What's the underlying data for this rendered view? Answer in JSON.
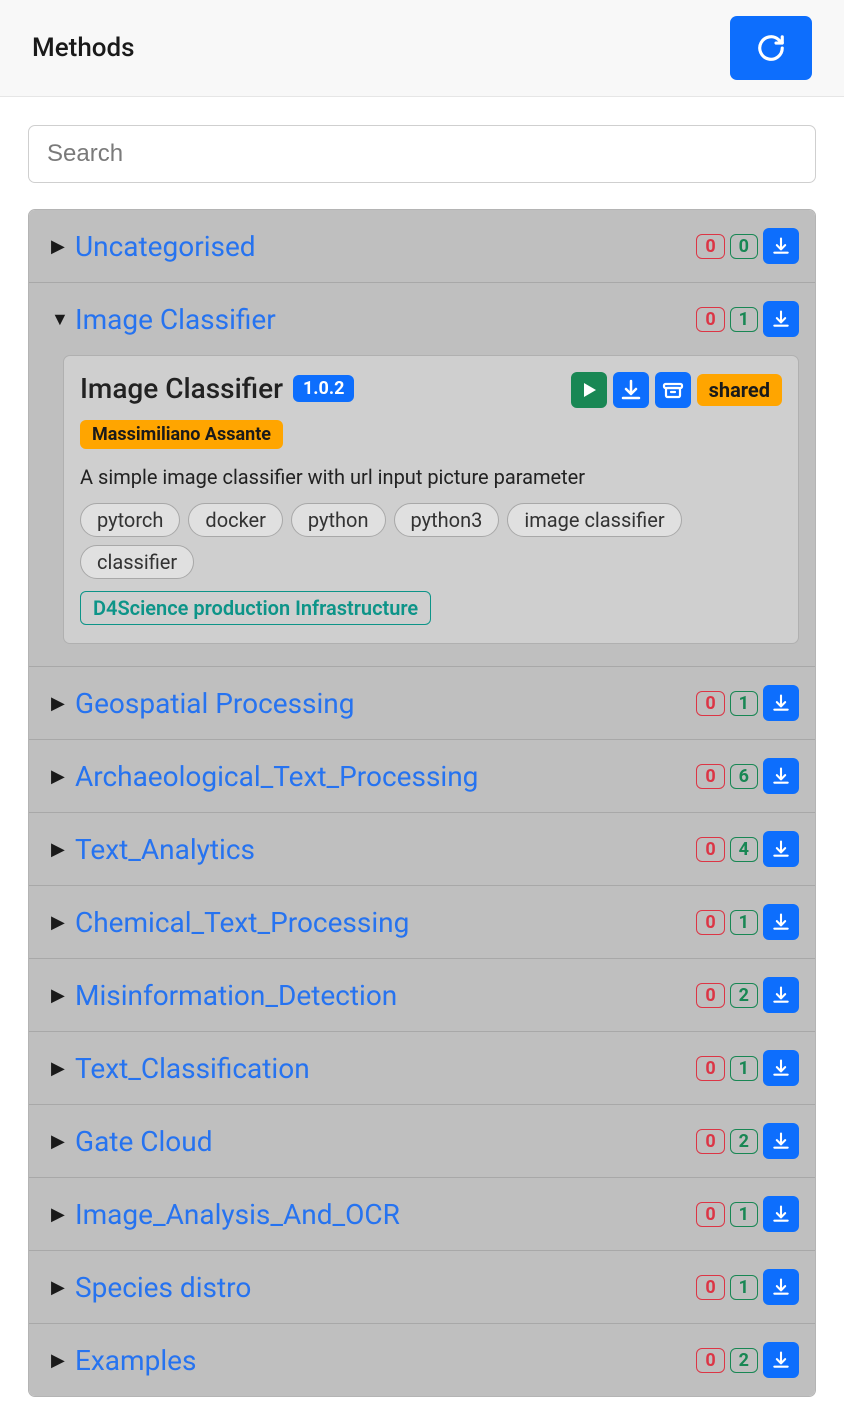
{
  "header": {
    "title": "Methods"
  },
  "search": {
    "placeholder": "Search"
  },
  "expanded": {
    "index": 1,
    "card": {
      "title": "Image Classifier",
      "version": "1.0.2",
      "author": "Massimiliano Assante",
      "shared_label": "shared",
      "description": "A simple image classifier with url input picture parameter",
      "tags": [
        "pytorch",
        "docker",
        "python",
        "python3",
        "image classifier",
        "classifier"
      ],
      "infra": "D4Science production Infrastructure"
    }
  },
  "categories": [
    {
      "name": "Uncategorised",
      "red": "0",
      "green": "0"
    },
    {
      "name": "Image Classifier",
      "red": "0",
      "green": "1"
    },
    {
      "name": "Geospatial Processing",
      "red": "0",
      "green": "1"
    },
    {
      "name": "Archaeological_Text_Processing",
      "red": "0",
      "green": "6"
    },
    {
      "name": "Text_Analytics",
      "red": "0",
      "green": "4"
    },
    {
      "name": "Chemical_Text_Processing",
      "red": "0",
      "green": "1"
    },
    {
      "name": "Misinformation_Detection",
      "red": "0",
      "green": "2"
    },
    {
      "name": "Text_Classification",
      "red": "0",
      "green": "1"
    },
    {
      "name": "Gate Cloud",
      "red": "0",
      "green": "2"
    },
    {
      "name": "Image_Analysis_And_OCR",
      "red": "0",
      "green": "1"
    },
    {
      "name": "Species distro",
      "red": "0",
      "green": "1"
    },
    {
      "name": "Examples",
      "red": "0",
      "green": "2"
    }
  ]
}
